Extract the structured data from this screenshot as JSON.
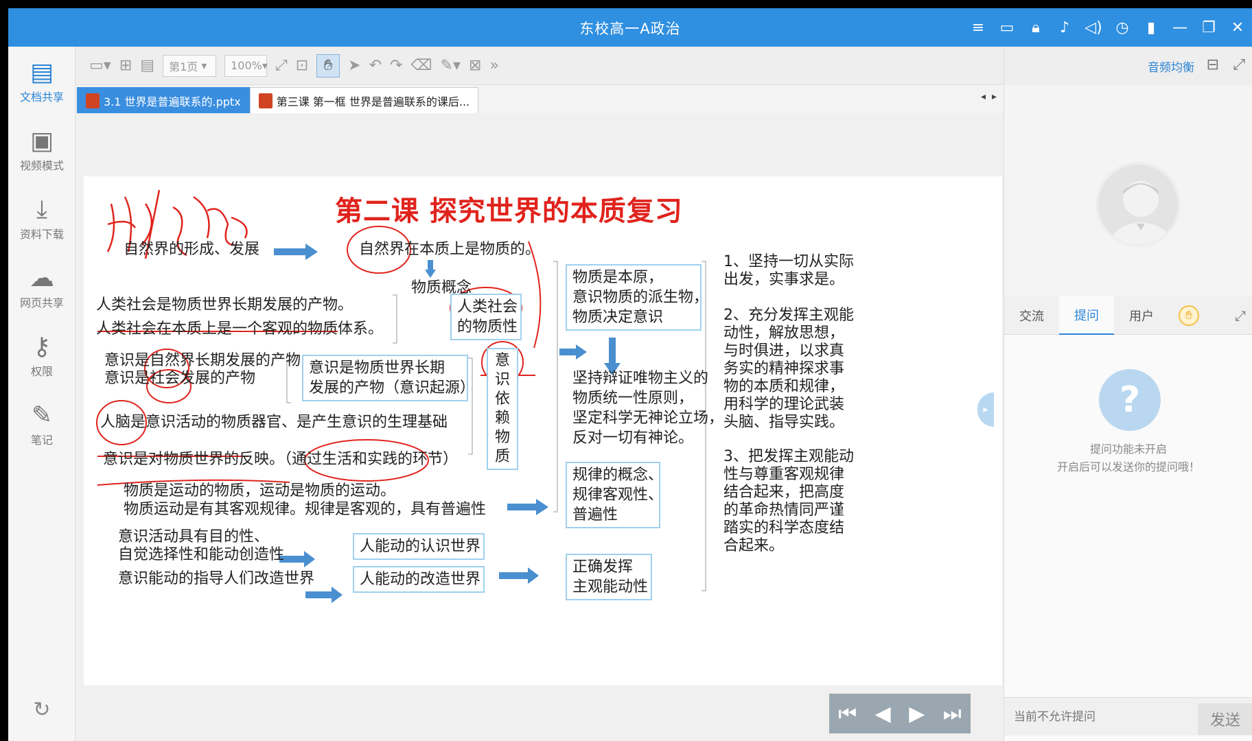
{
  "window": {
    "title": "东校高一A政治"
  },
  "titlebar_icons": [
    "menu-icon",
    "chat-icon",
    "lock-icon",
    "mic-icon",
    "speaker-icon",
    "clock-icon",
    "signal-icon",
    "minimize-icon",
    "restore-icon",
    "close-icon"
  ],
  "sidebar": {
    "items": [
      {
        "label": "文档共享",
        "icon": "document-share-icon",
        "active": true
      },
      {
        "label": "视频模式",
        "icon": "video-mode-icon"
      },
      {
        "label": "资料下载",
        "icon": "download-icon"
      },
      {
        "label": "网页共享",
        "icon": "web-share-icon"
      },
      {
        "label": "权限",
        "icon": "permission-icon"
      },
      {
        "label": "笔记",
        "icon": "notes-icon"
      }
    ]
  },
  "toolbar": {
    "page_select": "第1页",
    "zoom_select": "100%"
  },
  "doc_tabs": [
    {
      "label": "3.1 世界是普遍联系的.pptx",
      "active": true
    },
    {
      "label": "第三课 第一框 世界是普遍联系的课后...",
      "active": false
    }
  ],
  "slide": {
    "handwriting": "生3万/终结",
    "title": "第二课   探究世界的本质复习",
    "texts": {
      "t1": "自然界的形成、发展",
      "t2": "自然界在本质上是物质的。",
      "t3": "物质概念",
      "t4": "人类社会是物质世界长期发展的产物。",
      "t5": "人类社会在本质上是一个客观的物质体系。",
      "t6": "意识是自然界长期发展的产物",
      "t7": "意识是社会发展的产物",
      "t8": "人脑是意识活动的物质器官、是产生意识的生理基础",
      "t9": "意识是对物质世界的反映。（通过生活和实践的环节）",
      "t10": "物质是运动的物质，运动是物质的运动。",
      "t11": "物质运动是有其客观规律。规律是客观的，具有普遍性",
      "t12": "意识活动具有目的性、",
      "t13": "自觉选择性和能动创造性",
      "t14": "意识能动的指导人们改造世界"
    },
    "boxes": {
      "b1a": "人类社会",
      "b1b": "的物质性",
      "b2a": "意识是物质世界长期",
      "b2b": "发展的产物（意识起源）",
      "b3": "意识依赖物质",
      "b4a": "物质是本原，",
      "b4b": "意识物质的派生物，",
      "b4c": "物质决定意识",
      "b5a": "坚持辩证唯物主义的",
      "b5b": "物质统一性原则，",
      "b5c": "坚定科学无神论立场，",
      "b5d": "反对一切有神论。",
      "b6a": "规律的概念、",
      "b6b": "规律客观性、",
      "b6c": "普遍性",
      "b7": "人能动的认识世界",
      "b8": "人能动的改造世界",
      "b9a": "正确发挥",
      "b9b": "主观能动性"
    },
    "right": {
      "r1a": "1、坚持一切从实际",
      "r1b": "出发，实事求是。",
      "r2a": "2、充分发挥主观能",
      "r2b": "动性，解放思想，",
      "r2c": "与时俱进，以求真",
      "r2d": "务实的精神探求事",
      "r2e": "物的本质和规律，",
      "r2f": "用科学的理论武装",
      "r2g": "头脑、指导实践。",
      "r3a": "3、把发挥主观能动",
      "r3b": "性与尊重客观规律",
      "r3c": "结合起来，把高度",
      "r3d": "的革命热情同严谨",
      "r3e": "踏实的科学态度结",
      "r3f": "合起来。"
    },
    "accent_red": "#e0231c",
    "arrow_blue": "#4a8fd0"
  },
  "right_panel": {
    "audio_balance": "音频均衡",
    "tabs": [
      "交流",
      "提问",
      "用户"
    ],
    "active_tab": "提问",
    "empty_line1": "提问功能未开启",
    "empty_line2": "开启后可以发送你的提问哦！",
    "input_placeholder": "当前不允许提问",
    "send_label": "发送"
  }
}
